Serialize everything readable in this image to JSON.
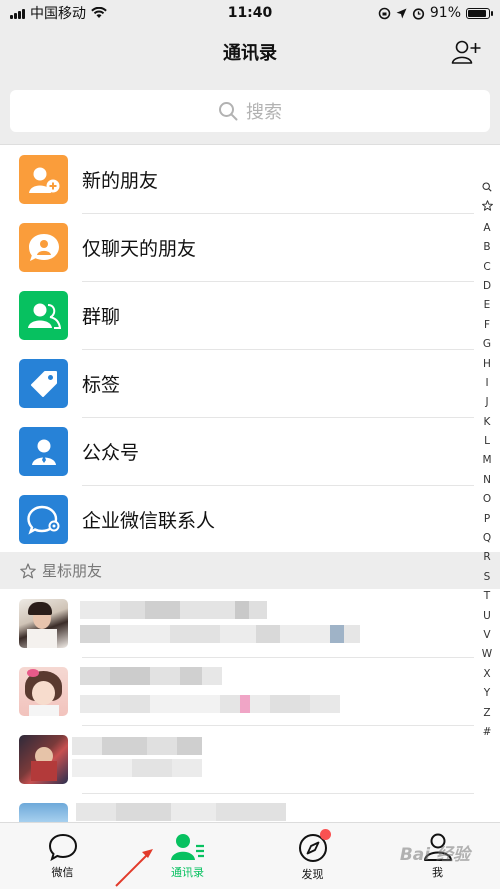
{
  "status_bar": {
    "carrier": "中国移动",
    "time": "11:40",
    "battery": "91%"
  },
  "nav": {
    "title": "通讯录",
    "add_icon": "add-friend-icon"
  },
  "search": {
    "placeholder": "搜索"
  },
  "functions": [
    {
      "label": "新的朋友",
      "icon": "new-friend-icon",
      "color": "#fa9d3b"
    },
    {
      "label": "仅聊天的朋友",
      "icon": "chat-only-icon",
      "color": "#fa9d3b"
    },
    {
      "label": "群聊",
      "icon": "group-chat-icon",
      "color": "#07c160"
    },
    {
      "label": "标签",
      "icon": "tag-icon",
      "color": "#2782d7"
    },
    {
      "label": "公众号",
      "icon": "official-account-icon",
      "color": "#2782d7"
    },
    {
      "label": "企业微信联系人",
      "icon": "wecom-icon",
      "color": "#2782d7"
    }
  ],
  "starred": {
    "header": "星标朋友"
  },
  "alphabet": [
    "A",
    "B",
    "C",
    "D",
    "E",
    "F",
    "G",
    "H",
    "I",
    "J",
    "K",
    "L",
    "M",
    "N",
    "O",
    "P",
    "Q",
    "R",
    "S",
    "T",
    "U",
    "V",
    "W",
    "X",
    "Y",
    "Z",
    "#"
  ],
  "tabs": [
    {
      "label": "微信",
      "icon": "chat-bubble-icon"
    },
    {
      "label": "通讯录",
      "icon": "contacts-icon"
    },
    {
      "label": "发现",
      "icon": "compass-icon"
    },
    {
      "label": "我",
      "icon": "person-icon"
    }
  ],
  "watermark": "Bai 经验",
  "colors": {
    "accent": "#07c160",
    "badge": "#fa5151",
    "orange": "#fa9d3b",
    "blue": "#2782d7"
  }
}
